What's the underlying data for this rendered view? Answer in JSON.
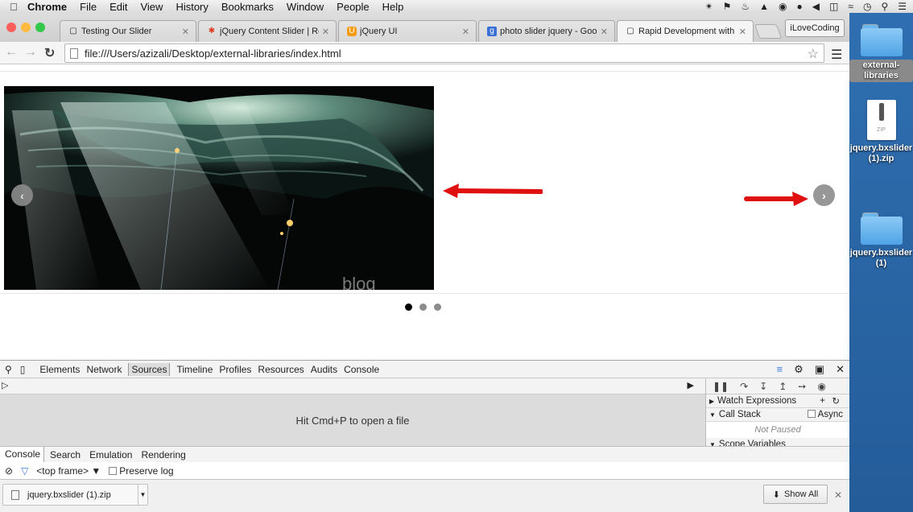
{
  "menubar": {
    "items": [
      "Chrome",
      "File",
      "Edit",
      "View",
      "History",
      "Bookmarks",
      "Window",
      "People",
      "Help"
    ]
  },
  "browser": {
    "tabs": [
      {
        "title": "Testing Our Slider",
        "icon": "page-icon"
      },
      {
        "title": "jQuery Content Slider | Res",
        "icon": "star-icon"
      },
      {
        "title": "jQuery UI",
        "icon": "jqueryui-icon"
      },
      {
        "title": "photo slider jquery - Googl",
        "icon": "google-icon"
      },
      {
        "title": "Rapid Development with E",
        "icon": "page-icon"
      }
    ],
    "active_tab": 4,
    "profile_label": "iLoveCoding",
    "address": "file:///Users/azizali/Desktop/external-libraries/index.html"
  },
  "page": {
    "image_watermark": "blog",
    "pager_count": 3,
    "pager_active": 0
  },
  "devtools": {
    "tabs": [
      "Elements",
      "Network",
      "Sources",
      "Timeline",
      "Profiles",
      "Resources",
      "Audits",
      "Console"
    ],
    "selected_tab": "Sources",
    "open_file_hint": "Hit Cmd+P to open a file",
    "watch_expressions": "Watch Expressions",
    "call_stack": "Call Stack",
    "async_label": "Async",
    "not_paused": "Not Paused",
    "scope_variables": "Scope Variables",
    "drawer_tabs": [
      "Console",
      "Search",
      "Emulation",
      "Rendering"
    ],
    "frame_label": "<top frame>",
    "preserve_log": "Preserve log"
  },
  "shelf": {
    "download_name": "jquery.bxslider (1).zip",
    "show_all": "Show All"
  },
  "desktop": {
    "items": [
      {
        "label": "external-libraries",
        "type": "folder"
      },
      {
        "label": "jquery.bxslider (1).zip",
        "type": "zip"
      },
      {
        "label": "jquery.bxslider (1)",
        "type": "folder"
      }
    ],
    "zip_badge": "ZIP"
  },
  "colors": {
    "desktop_blue": "#2f6fb1",
    "annotation_arrow": "#e01010",
    "slider_control": "#8c8c8c"
  }
}
